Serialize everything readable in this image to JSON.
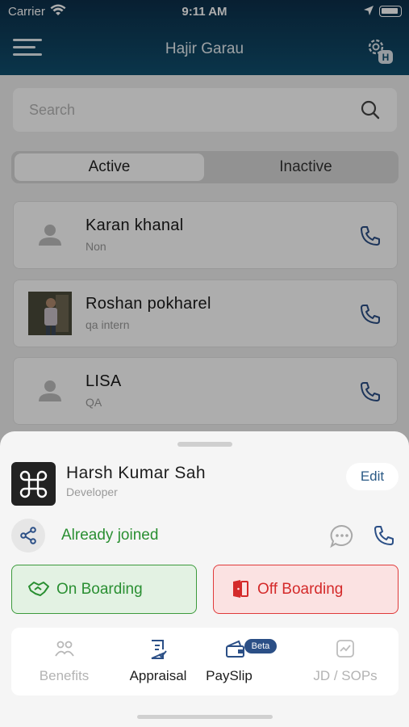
{
  "status_bar": {
    "carrier": "Carrier",
    "time": "9:11 AM"
  },
  "header": {
    "title": "Hajir Garau",
    "settings_badge": "H"
  },
  "search": {
    "placeholder": "Search"
  },
  "segments": {
    "active": "Active",
    "inactive": "Inactive"
  },
  "employees": [
    {
      "name": "Karan khanal",
      "role": "Non"
    },
    {
      "name": "Roshan pokharel",
      "role": "qa intern"
    },
    {
      "name": "LISA",
      "role": "QA"
    }
  ],
  "sheet": {
    "name": "Harsh Kumar Sah",
    "role": "Developer",
    "edit_label": "Edit",
    "joined_text": "Already joined",
    "on_boarding_label": "On Boarding",
    "off_boarding_label": "Off Boarding",
    "tiles": [
      {
        "label": "Benefits",
        "icon": "benefits-icon",
        "enabled": false
      },
      {
        "label": "Appraisal",
        "icon": "appraisal-icon",
        "enabled": true
      },
      {
        "label": "PaySlip",
        "icon": "wallet-icon",
        "enabled": true,
        "badge": "Beta"
      },
      {
        "label": "JD / SOPs",
        "icon": "chart-icon",
        "enabled": false
      }
    ]
  },
  "colors": {
    "header": "#0f4f6e",
    "accent": "#2b4f86",
    "green": "#2a8f32",
    "red": "#d42a2a"
  }
}
